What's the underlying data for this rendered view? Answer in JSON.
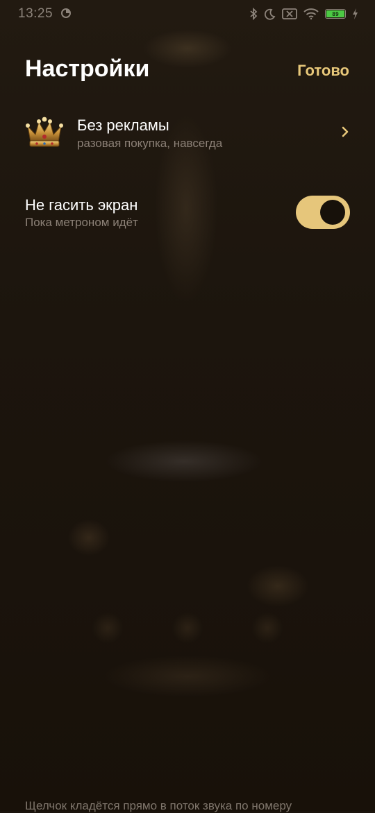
{
  "status_bar": {
    "time": "13:25",
    "battery_level": "89",
    "icons": [
      "sync-icon",
      "bluetooth-icon",
      "moon-icon",
      "sim-off-icon",
      "wifi-icon",
      "battery-icon",
      "charging-icon"
    ]
  },
  "header": {
    "title": "Настройки",
    "done_label": "Готово"
  },
  "settings": {
    "no_ads": {
      "icon": "crown-icon",
      "title": "Без рекламы",
      "subtitle": "разовая покупка, навсегда",
      "chevron": "›"
    },
    "keep_screen_on": {
      "title": "Не гасить экран",
      "subtitle": "Пока метроном идёт",
      "enabled": true
    }
  },
  "footnote": "Щелчок кладётся прямо в поток звука по номеру",
  "colors": {
    "accent": "#e8c87a",
    "background": "#1b140d",
    "secondary_text": "#8c8177",
    "battery_fill": "#4cc944"
  }
}
